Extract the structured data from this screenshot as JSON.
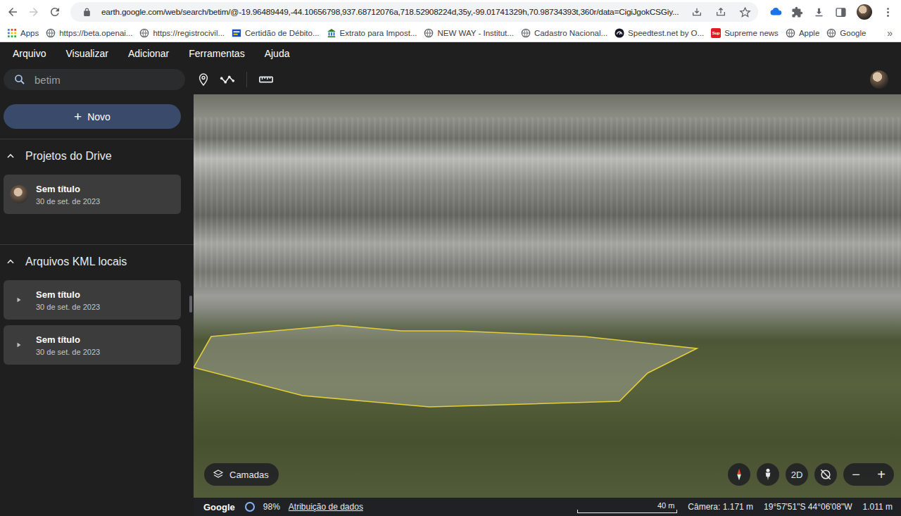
{
  "browser": {
    "url": "earth.google.com/web/search/betim/@-19.96489449,-44.10656798,937.68712076a,718.52908224d,35y,-99.01741329h,70.98734393t,360r/data=CigiJgokCSGiy...",
    "back_enabled": true,
    "forward_enabled": false,
    "bookmarks": [
      {
        "label": "Apps",
        "kind": "apps"
      },
      {
        "label": "https://beta.openai...",
        "kind": "globe"
      },
      {
        "label": "https://registrocivil...",
        "kind": "globe"
      },
      {
        "label": "Certidão de Débito...",
        "kind": "gov"
      },
      {
        "label": "Extrato para Impost...",
        "kind": "tax"
      },
      {
        "label": "NEW WAY - Institut...",
        "kind": "globe"
      },
      {
        "label": "Cadastro Nacional...",
        "kind": "globe"
      },
      {
        "label": "Speedtest.net by O...",
        "kind": "speedtest"
      },
      {
        "label": "Supreme news",
        "kind": "badge",
        "icon_text": "Sup"
      },
      {
        "label": "Apple",
        "kind": "globe"
      },
      {
        "label": "Google",
        "kind": "globe"
      }
    ],
    "more": "»"
  },
  "menu": [
    "Arquivo",
    "Visualizar",
    "Adicionar",
    "Ferramentas",
    "Ajuda"
  ],
  "search": {
    "value": "betim"
  },
  "sidebar": {
    "new_button": {
      "icon": "+",
      "label": "Novo"
    },
    "sections": [
      {
        "title": "Projetos do Drive",
        "expanded": true,
        "items": [
          {
            "title": "Sem título",
            "date": "30 de set. de 2023",
            "kind": "project"
          }
        ]
      },
      {
        "title": "Arquivos KML locais",
        "expanded": true,
        "items": [
          {
            "title": "Sem título",
            "date": "30 de set. de 2023",
            "kind": "kml"
          },
          {
            "title": "Sem título",
            "date": "30 de set. de 2023",
            "kind": "kml"
          }
        ]
      }
    ]
  },
  "map": {
    "layers_button": "Camadas",
    "view_toggle": "2D",
    "zoom_out": "−",
    "zoom_in": "+"
  },
  "status_bar": {
    "logo": "Google",
    "load": "98%",
    "attribution": "Atribuição de dados",
    "scale": "40 m",
    "camera": "Câmera: 1.171 m",
    "coords": "19°57'51\"S 44°06'08\"W",
    "elevation": "1.011 m"
  }
}
